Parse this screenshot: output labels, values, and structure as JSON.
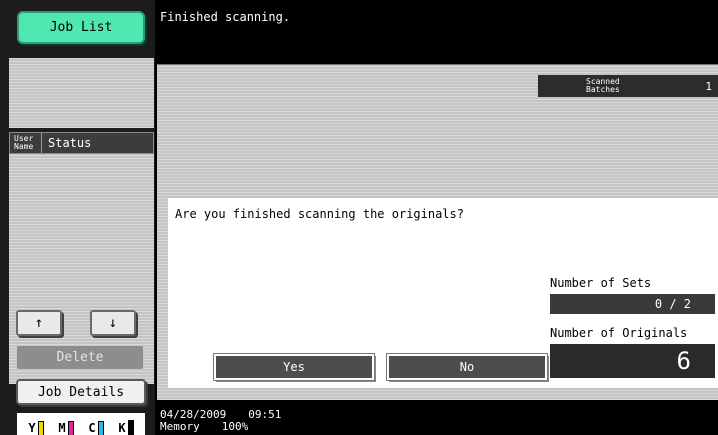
{
  "sidebar": {
    "job_list_label": "Job List",
    "columns": {
      "user_name": [
        "User",
        "Name"
      ],
      "status": "Status"
    },
    "up_icon": "↑",
    "down_icon": "↓",
    "delete_label": "Delete",
    "job_details_label": "Job Details",
    "toner": [
      {
        "letter": "Y",
        "color": "#f5d800",
        "level": 0.9
      },
      {
        "letter": "M",
        "color": "#e0249a",
        "level": 0.9
      },
      {
        "letter": "C",
        "color": "#28b8e6",
        "level": 0.9
      },
      {
        "letter": "K",
        "color": "#000000",
        "level": 1.0
      }
    ]
  },
  "main": {
    "message": "Finished scanning.",
    "scanned_batches": {
      "label": [
        "Scanned",
        "Batches"
      ],
      "value": "1"
    },
    "dialog": {
      "question": "Are you finished scanning the originals?",
      "yes_label": "Yes",
      "no_label": "No",
      "sets_label": "Number of Sets",
      "sets_value": "0 / 2",
      "originals_label": "Number of Originals",
      "originals_value": "6"
    }
  },
  "footer": {
    "date": "04/28/2009",
    "time": "09:51",
    "memory_label": "Memory",
    "memory_value": "100%"
  }
}
